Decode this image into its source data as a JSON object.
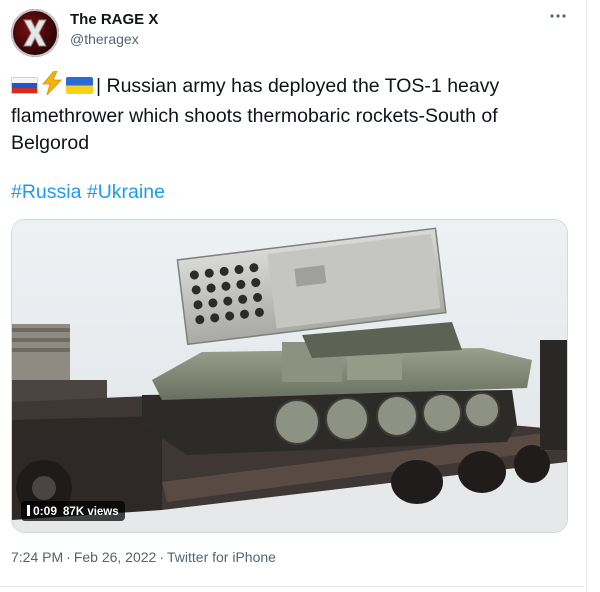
{
  "author": {
    "name": "The RAGE X",
    "handle": "@theragex",
    "avatar_icon": "rage-x-logo"
  },
  "tweet": {
    "flags": [
      "flag-russia",
      "lightning-bolt",
      "flag-ukraine"
    ],
    "body": "| Russian army has deployed the TOS-1 heavy flamethrower which shoots thermobaric rockets-South of Belgorod",
    "hashtags": [
      "#Russia",
      "#Ukraine"
    ]
  },
  "media": {
    "duration": "0:09",
    "views": "87K views"
  },
  "meta": {
    "time": "7:24 PM",
    "date": "Feb 26, 2022",
    "separator": "·",
    "source": "Twitter for iPhone"
  },
  "colors": {
    "link": "#1d9bf0",
    "secondary_text": "#536471",
    "primary_text": "#0f1419",
    "border": "#e7e9ea"
  }
}
